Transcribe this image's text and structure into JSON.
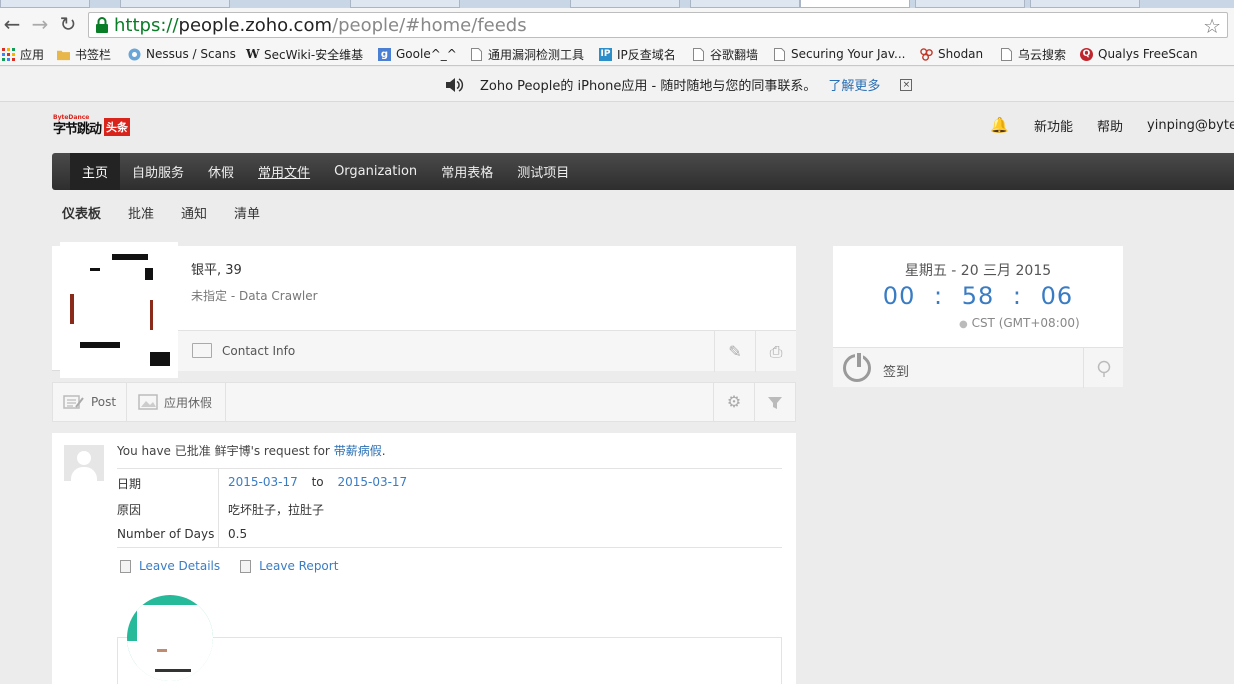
{
  "browser": {
    "url": {
      "scheme": "https://",
      "host": "people.zoho.com",
      "path": "/people/#home/feeds"
    },
    "bookmarks": [
      {
        "label": "应用",
        "icon": "apps-grid-icon"
      },
      {
        "label": "书签栏",
        "icon": "folder-icon"
      },
      {
        "label": "Nessus / Scans",
        "icon": "nessus-icon"
      },
      {
        "label": "SecWiki-安全维基",
        "icon": "wiki-w-icon"
      },
      {
        "label": "Goole^_^",
        "icon": "google-g-icon"
      },
      {
        "label": "通用漏洞检测工具",
        "icon": "page-icon"
      },
      {
        "label": "IP反查域名",
        "icon": "ip-icon"
      },
      {
        "label": "谷歌翻墙",
        "icon": "page-icon"
      },
      {
        "label": "Securing Your Jav...",
        "icon": "page-icon"
      },
      {
        "label": "Shodan",
        "icon": "shodan-icon"
      },
      {
        "label": "乌云搜索",
        "icon": "page-icon"
      },
      {
        "label": "Qualys FreeScan",
        "icon": "qualys-icon"
      }
    ]
  },
  "infobar": {
    "message": "Zoho People的 iPhone应用 - 随时随地与您的同事联系。",
    "more": "了解更多"
  },
  "header": {
    "logo_small": "ByteDance",
    "logo_text": "字节跳动",
    "logo_tag": "头条",
    "links": [
      "新功能",
      "帮助"
    ],
    "user": "yinping@byteda"
  },
  "nav": {
    "items": [
      "主页",
      "自助服务",
      "休假",
      "常用文件",
      "Organization",
      "常用表格",
      "测试项目"
    ]
  },
  "subnav": {
    "items": [
      "仪表板",
      "批准",
      "通知",
      "清单"
    ]
  },
  "profile": {
    "name": "银平, 39",
    "role": "未指定 - Data Crawler",
    "contact": "Contact Info"
  },
  "postbar": {
    "post": "Post",
    "leave": "应用休假"
  },
  "clock": {
    "date": "星期五 - 20 三月 2015",
    "hh": "00",
    "mm": "58",
    "ss": "06",
    "sep": ":",
    "tz": "CST (GMT+08:00)",
    "checkin": "签到"
  },
  "feed": {
    "prefix": "You have 已批准 鲜宇博's request for ",
    "leave_type": "带薪病假",
    "suffix": ".",
    "rows": {
      "date_label": "日期",
      "from": "2015-03-17",
      "to_word": "to",
      "to": "2015-03-17",
      "reason_label": "原因",
      "reason": "吃坏肚子，拉肚子",
      "days_label": "Number of Days",
      "days": "0.5"
    },
    "leave_details": "Leave Details",
    "leave_report": "Leave Report"
  }
}
